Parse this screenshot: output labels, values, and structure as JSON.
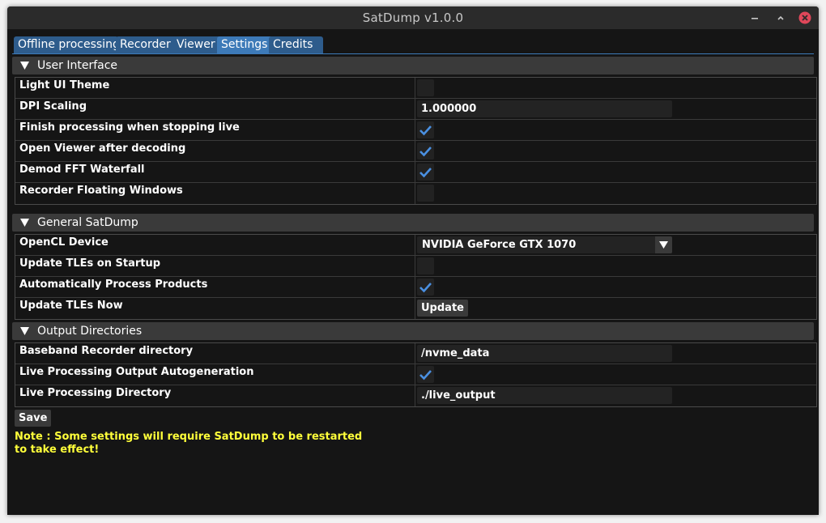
{
  "window": {
    "title": "SatDump v1.0.0"
  },
  "tabs": [
    {
      "label": "Offline processing",
      "active": false
    },
    {
      "label": "Recorder",
      "active": false
    },
    {
      "label": "Viewer",
      "active": false
    },
    {
      "label": "Settings",
      "active": true
    },
    {
      "label": "Credits",
      "active": false
    }
  ],
  "sections": {
    "user_interface": {
      "title": "User Interface",
      "light_ui_theme": {
        "label": "Light UI Theme",
        "checked": false
      },
      "dpi_scaling": {
        "label": "DPI Scaling",
        "value": "1.000000"
      },
      "finish_processing": {
        "label": "Finish processing when stopping live",
        "checked": true
      },
      "open_viewer": {
        "label": "Open Viewer after decoding",
        "checked": true
      },
      "demod_fft": {
        "label": "Demod FFT Waterfall",
        "checked": true
      },
      "recorder_floating": {
        "label": "Recorder Floating Windows",
        "checked": false
      }
    },
    "general": {
      "title": "General SatDump",
      "opencl_device": {
        "label": "OpenCL Device",
        "value": "NVIDIA GeForce GTX 1070"
      },
      "update_tles_startup": {
        "label": "Update TLEs on Startup",
        "checked": false
      },
      "auto_process": {
        "label": "Automatically Process Products",
        "checked": true
      },
      "update_tles_now": {
        "label": "Update TLEs Now",
        "button": "Update"
      }
    },
    "output": {
      "title": "Output Directories",
      "baseband_dir": {
        "label": "Baseband Recorder directory",
        "value": "/nvme_data"
      },
      "live_autogen": {
        "label": "Live Processing Output Autogeneration",
        "checked": true
      },
      "live_dir": {
        "label": "Live Processing Directory",
        "value": "./live_output"
      }
    }
  },
  "footer": {
    "save_label": "Save",
    "note_line1": "Note : Some settings will require SatDump to be restarted",
    "note_line2": "to take effect!"
  },
  "colors": {
    "accent": "#3d7ab8",
    "tab": "#2e5c8c",
    "check": "#4a90e2",
    "note": "#ffff3a",
    "close": "#e0475a"
  },
  "icons": {
    "minimize": "minimize-icon",
    "maximize": "maximize-icon",
    "close": "close-icon",
    "collapse": "triangle-down-icon",
    "check": "checkmark-icon",
    "dropdown": "triangle-down-icon"
  }
}
